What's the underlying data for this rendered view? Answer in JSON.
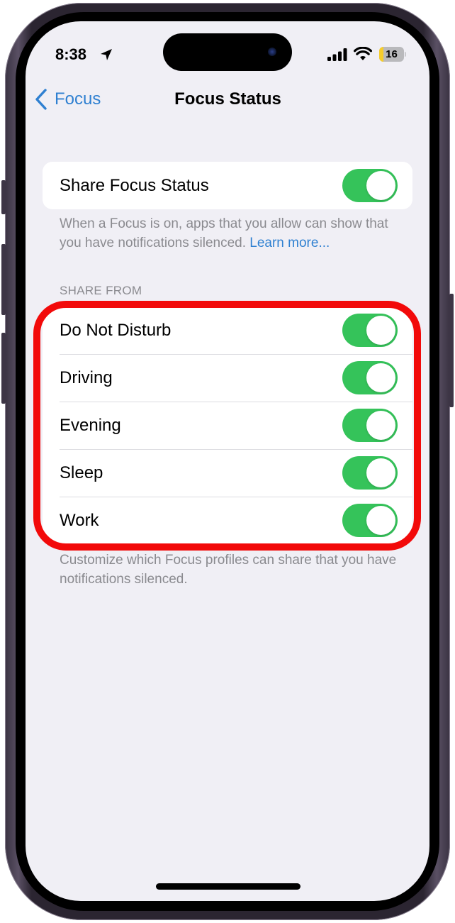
{
  "status_bar": {
    "time": "8:38",
    "location_icon": "location-arrow-icon",
    "signal_icon": "cellular-signal-icon",
    "wifi_icon": "wifi-icon",
    "battery_percent": "16",
    "battery_level": 0.16,
    "battery_color": "#f6cd2c"
  },
  "nav": {
    "back_label": "Focus",
    "back_icon": "chevron-left-icon",
    "title": "Focus Status"
  },
  "share_status": {
    "label": "Share Focus Status",
    "enabled": true,
    "footer": "When a Focus is on, apps that you allow can show that you have notifications silenced. ",
    "learn_more": "Learn more..."
  },
  "share_from": {
    "header": "SHARE FROM",
    "items": [
      {
        "label": "Do Not Disturb",
        "enabled": true
      },
      {
        "label": "Driving",
        "enabled": true
      },
      {
        "label": "Evening",
        "enabled": true
      },
      {
        "label": "Sleep",
        "enabled": true
      },
      {
        "label": "Work",
        "enabled": true
      }
    ],
    "footer": "Customize which Focus profiles can share that you have notifications silenced."
  },
  "colors": {
    "accent": "#2f80d1",
    "toggle_on": "#35c35a",
    "annotation": "#f20a0a",
    "background": "#f0eff5"
  }
}
